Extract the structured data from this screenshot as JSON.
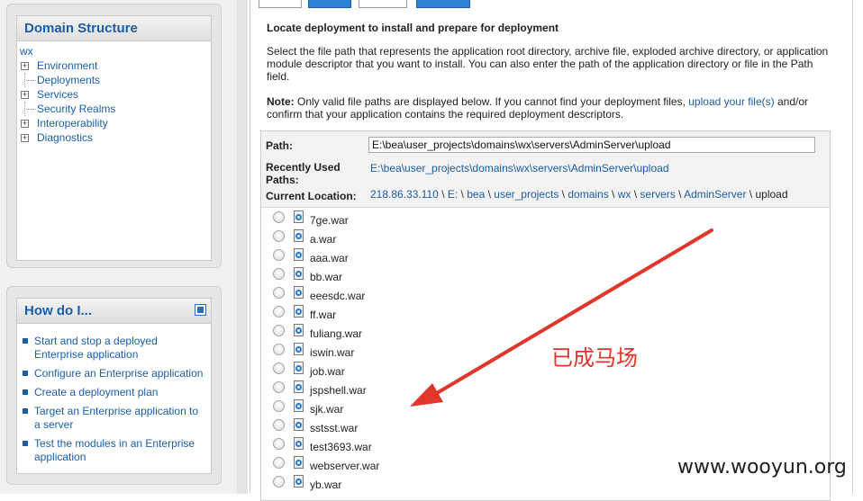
{
  "domain_structure": {
    "title": "Domain Structure",
    "root": "wx",
    "items": [
      {
        "label": "Environment",
        "expandable": true
      },
      {
        "label": "Deployments",
        "expandable": false
      },
      {
        "label": "Services",
        "expandable": true
      },
      {
        "label": "Security Realms",
        "expandable": false
      },
      {
        "label": "Interoperability",
        "expandable": true
      },
      {
        "label": "Diagnostics",
        "expandable": true
      }
    ]
  },
  "how_do_i": {
    "title": "How do I...",
    "items": [
      "Start and stop a deployed Enterprise application",
      "Configure an Enterprise application",
      "Create a deployment plan",
      "Target an Enterprise application to a server",
      "Test the modules in an Enterprise application"
    ]
  },
  "main": {
    "title": "Locate deployment to install and prepare for deployment",
    "description": "Select the file path that represents the application root directory, archive file, exploded archive directory, or application module descriptor that you want to install. You can also enter the path of the application directory or file in the Path field.",
    "note_label": "Note:",
    "note_text_1": " Only valid file paths are displayed below. If you cannot find your deployment files, ",
    "note_link": "upload your file(s)",
    "note_text_2": " and/or confirm that your application contains the required deployment descriptors.",
    "path_label": "Path:",
    "path_value": "E:\\bea\\user_projects\\domains\\wx\\servers\\AdminServer\\upload",
    "recent_label": "Recently Used Paths:",
    "recent_value": "E:\\bea\\user_projects\\domains\\wx\\servers\\AdminServer\\upload",
    "current_label": "Current Location:",
    "current_segments": [
      "218.86.33.110",
      "E:",
      "bea",
      "user_projects",
      "domains",
      "wx",
      "servers",
      "AdminServer",
      "upload"
    ],
    "files": [
      "7ge.war",
      "a.war",
      "aaa.war",
      "bb.war",
      "eeesdc.war",
      "ff.war",
      "fuliang.war",
      "iswin.war",
      "job.war",
      "jspshell.war",
      "sjk.war",
      "sstsst.war",
      "test3693.war",
      "webserver.war",
      "yb.war"
    ]
  },
  "annotation": {
    "text": "已成马场",
    "color": "#e0362b"
  },
  "watermark": "www.wooyun.org",
  "colors": {
    "link": "#1a5ea8",
    "accent_button": "#2d83d6"
  }
}
